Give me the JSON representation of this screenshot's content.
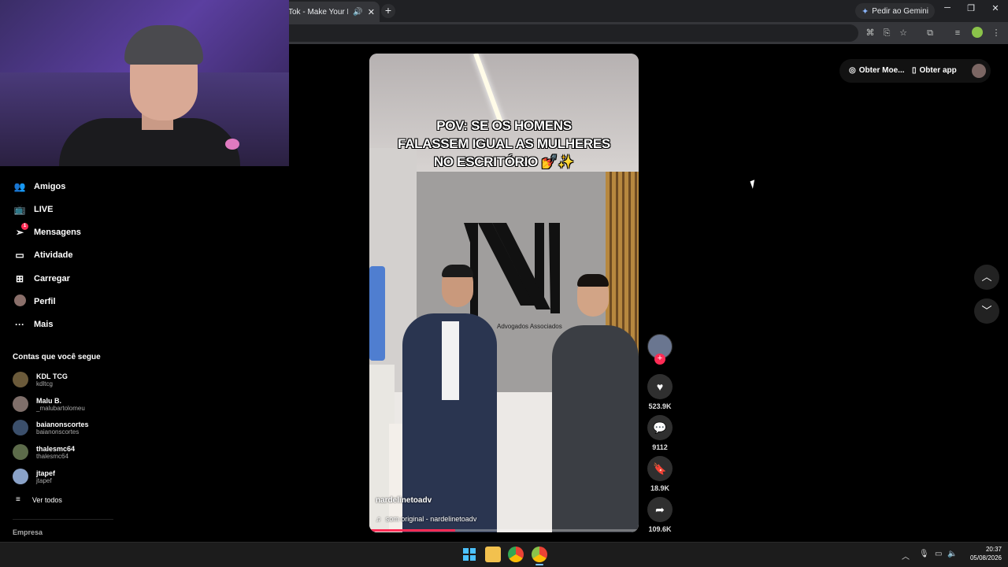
{
  "browser": {
    "tab_title": "Tok - Make Your Day",
    "gemini_label": "Pedir ao Gemini",
    "icons": [
      "audio-icon",
      "close-icon",
      "new-tab-icon",
      "translate-icon",
      "install-icon",
      "star-icon",
      "extensions-icon",
      "media-icon",
      "menu-icon"
    ]
  },
  "sidebar": {
    "items": [
      {
        "label": "Amigos",
        "icon": "friends-icon"
      },
      {
        "label": "LIVE",
        "icon": "live-icon"
      },
      {
        "label": "Mensagens",
        "icon": "messages-icon",
        "badge": "1"
      },
      {
        "label": "Atividade",
        "icon": "activity-icon"
      },
      {
        "label": "Carregar",
        "icon": "upload-icon"
      },
      {
        "label": "Perfil",
        "icon": "profile-avatar"
      },
      {
        "label": "Mais",
        "icon": "more-icon"
      }
    ],
    "following_title": "Contas que você segue",
    "following": [
      {
        "name": "KDL TCG",
        "handle": "kdltcg",
        "color": "#6b5a3a"
      },
      {
        "name": "Malu B.",
        "handle": "_malubartolomeu",
        "color": "#7f6f6a"
      },
      {
        "name": "baianonscortes",
        "handle": "baianonscortes",
        "color": "#3b4f6b"
      },
      {
        "name": "thalesmc64",
        "handle": "thalesmc64",
        "color": "#5c6b4a"
      },
      {
        "name": "jtapef",
        "handle": "jtapef",
        "color": "#8aa2c8"
      }
    ],
    "see_all": "Ver todos",
    "footer": "Empresa"
  },
  "video": {
    "caption_lines": [
      "POV: SE OS HOMENS",
      "FALASSEM IGUAL AS MULHERES",
      "NO ESCRITÓRIO 💅✨"
    ],
    "firm_text": "Advogados Associados",
    "author": "nardelinetoadv",
    "sound": "som original - nardelinetoadv",
    "progress": 0.32
  },
  "actions": {
    "likes": "523.9K",
    "comments": "9112",
    "saves": "18.9K",
    "shares": "109.6K"
  },
  "topbar": {
    "coins_label": "Obter Moe...",
    "app_label": "Obter app"
  },
  "taskbar": {
    "time": "20:37",
    "date": "05/08/2026"
  },
  "colors": {
    "accent": "#fe2c55",
    "background": "#000000"
  }
}
